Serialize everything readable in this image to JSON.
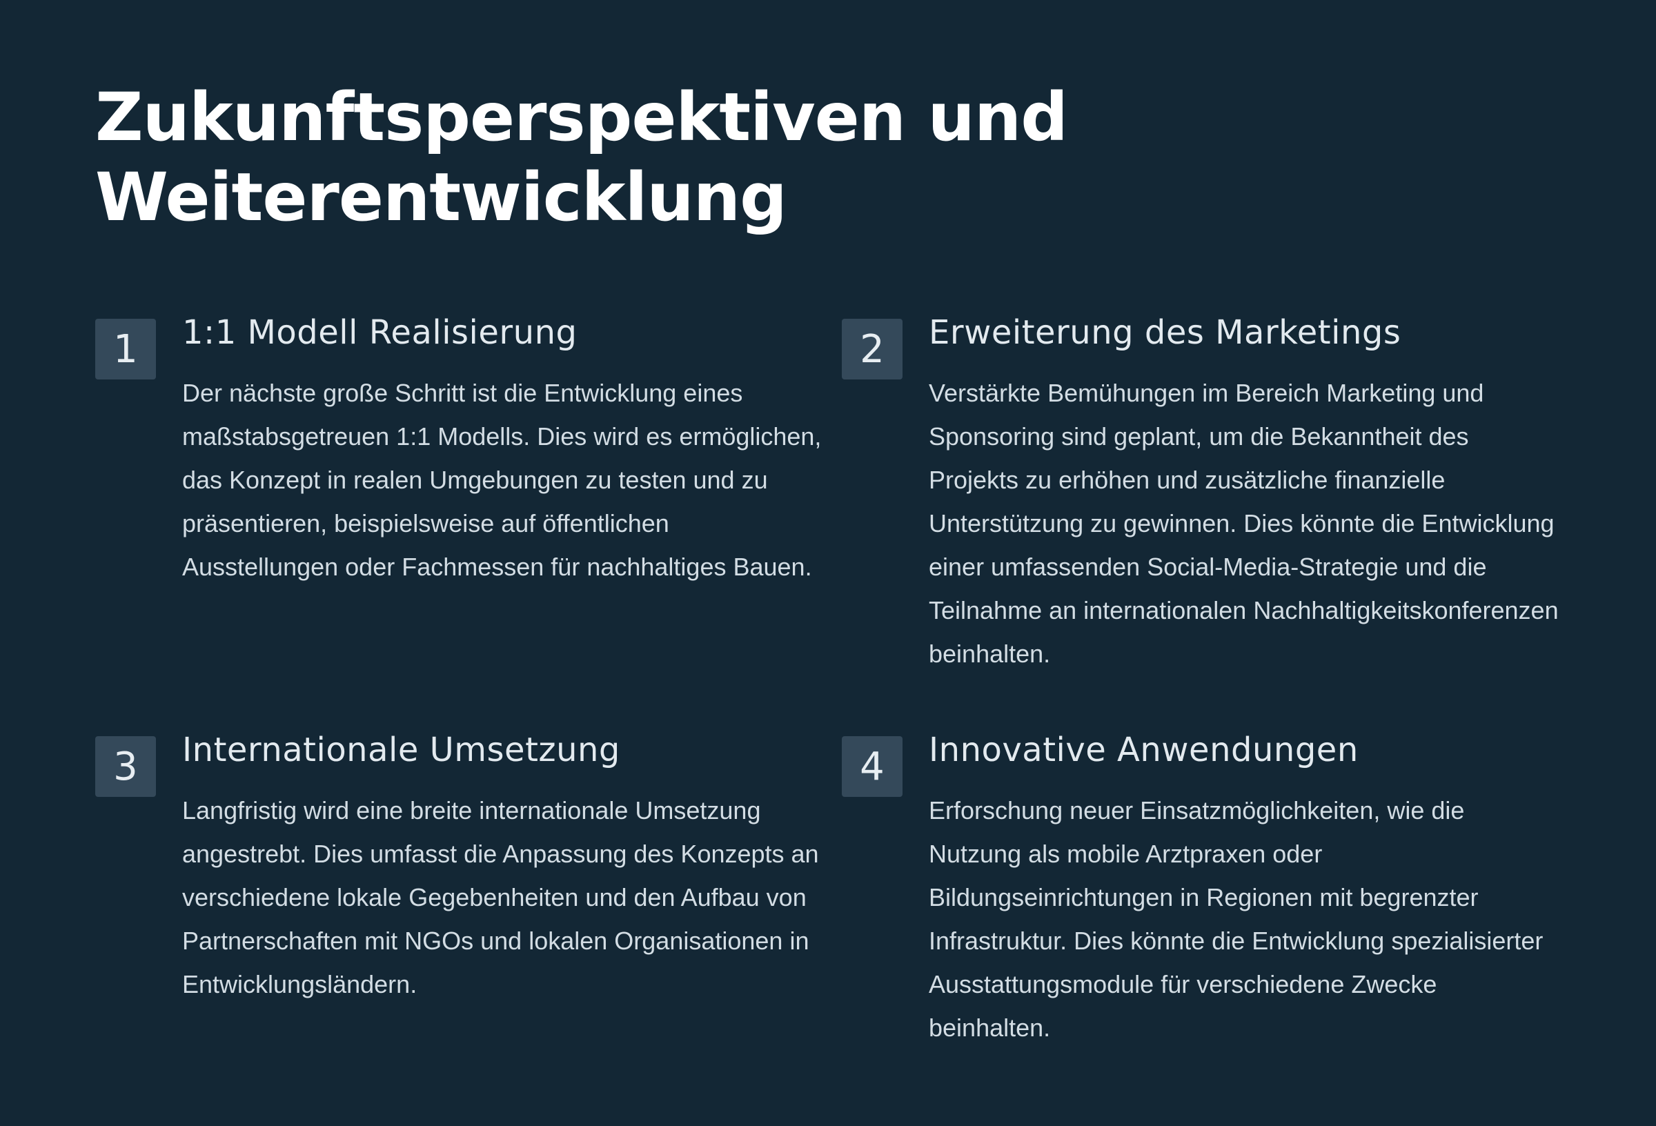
{
  "page": {
    "title_line1": "Zukunftsperspektiven und",
    "title_line2": "Weiterentwicklung"
  },
  "colors": {
    "background": "#132735",
    "badge": "#34495a",
    "title": "#ffffff",
    "text": "#d3dde4"
  },
  "cards": [
    {
      "number": "1",
      "title": "1:1 Modell Realisierung",
      "text": "Der nächste große Schritt ist die Entwicklung eines maßstabsgetreuen 1:1 Modells. Dies wird es ermöglichen, das Konzept in realen Umgebungen zu testen und zu präsentieren, beispielsweise auf öffentlichen Ausstellungen oder Fachmessen für nachhaltiges Bauen."
    },
    {
      "number": "2",
      "title": "Erweiterung des Marketings",
      "text": "Verstärkte Bemühungen im Bereich Marketing und Sponsoring sind geplant, um die Bekanntheit des Projekts zu erhöhen und zusätzliche finanzielle Unterstützung zu gewinnen. Dies könnte die Entwicklung einer umfassenden Social-Media-Strategie und die Teilnahme an internationalen Nachhaltigkeitskonferenzen beinhalten."
    },
    {
      "number": "3",
      "title": "Internationale Umsetzung",
      "text": "Langfristig wird eine breite internationale Umsetzung angestrebt. Dies umfasst die Anpassung des Konzepts an verschiedene lokale Gegebenheiten und den Aufbau von Partnerschaften mit NGOs und lokalen Organisationen in Entwicklungsländern."
    },
    {
      "number": "4",
      "title": "Innovative Anwendungen",
      "text": "Erforschung neuer Einsatzmöglichkeiten, wie die Nutzung als mobile Arztpraxen oder Bildungseinrichtungen in Regionen mit begrenzter Infrastruktur. Dies könnte die Entwicklung spezialisierter Ausstattungsmodule für verschiedene Zwecke beinhalten."
    }
  ]
}
